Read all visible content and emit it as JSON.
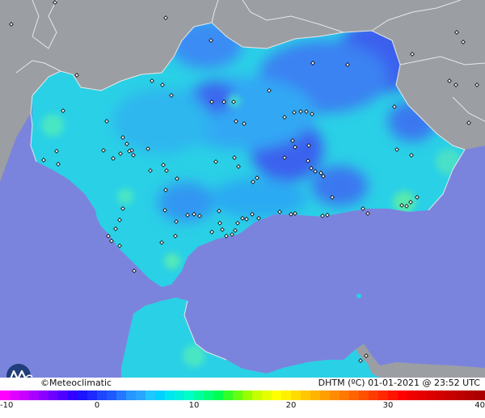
{
  "credit": "©Meteoclimatic",
  "title": "DHTM (ºC)  01-01-2021 @ 23:52 UTC",
  "colorbar": {
    "ticks": [
      "-10",
      "0",
      "10",
      "20",
      "30",
      "40"
    ],
    "min": -10,
    "max": 40,
    "colors": [
      "#ff00ff",
      "#e100ff",
      "#c800ff",
      "#aa00ff",
      "#8c00ff",
      "#6e00ff",
      "#5000ff",
      "#3200ff",
      "#1a14ff",
      "#1e28ff",
      "#1e46ff",
      "#1e5aff",
      "#2378ff",
      "#2896ff",
      "#2aa5ff",
      "#20c8ff",
      "#00d2ff",
      "#00e6f0",
      "#00f0dc",
      "#00ffc8",
      "#00ffa0",
      "#00ff78",
      "#00ff50",
      "#32ff28",
      "#64ff14",
      "#96ff00",
      "#c8ff00",
      "#e6ff00",
      "#ffff00",
      "#fff000",
      "#ffdc00",
      "#ffc800",
      "#ffb400",
      "#ffa000",
      "#ff8c00",
      "#ff7800",
      "#ff6400",
      "#ff5000",
      "#ff3c00",
      "#ff2800",
      "#ff1400",
      "#ff0000",
      "#f00000",
      "#e60000",
      "#dc0000",
      "#d20000",
      "#c80000",
      "#be0000",
      "#b40000",
      "#aa0000"
    ]
  },
  "colors": {
    "sea": "#7b84dd",
    "land_outside": "#9b9ea3",
    "land_inside": "#2ad0e6",
    "cold_core": "#4a64f0",
    "warm_spot": "#3be6c0",
    "border_lines": "#e8e8e8"
  },
  "icons": {
    "logo": "meteoclimatic-logo-icon",
    "station": "station-marker-icon"
  }
}
